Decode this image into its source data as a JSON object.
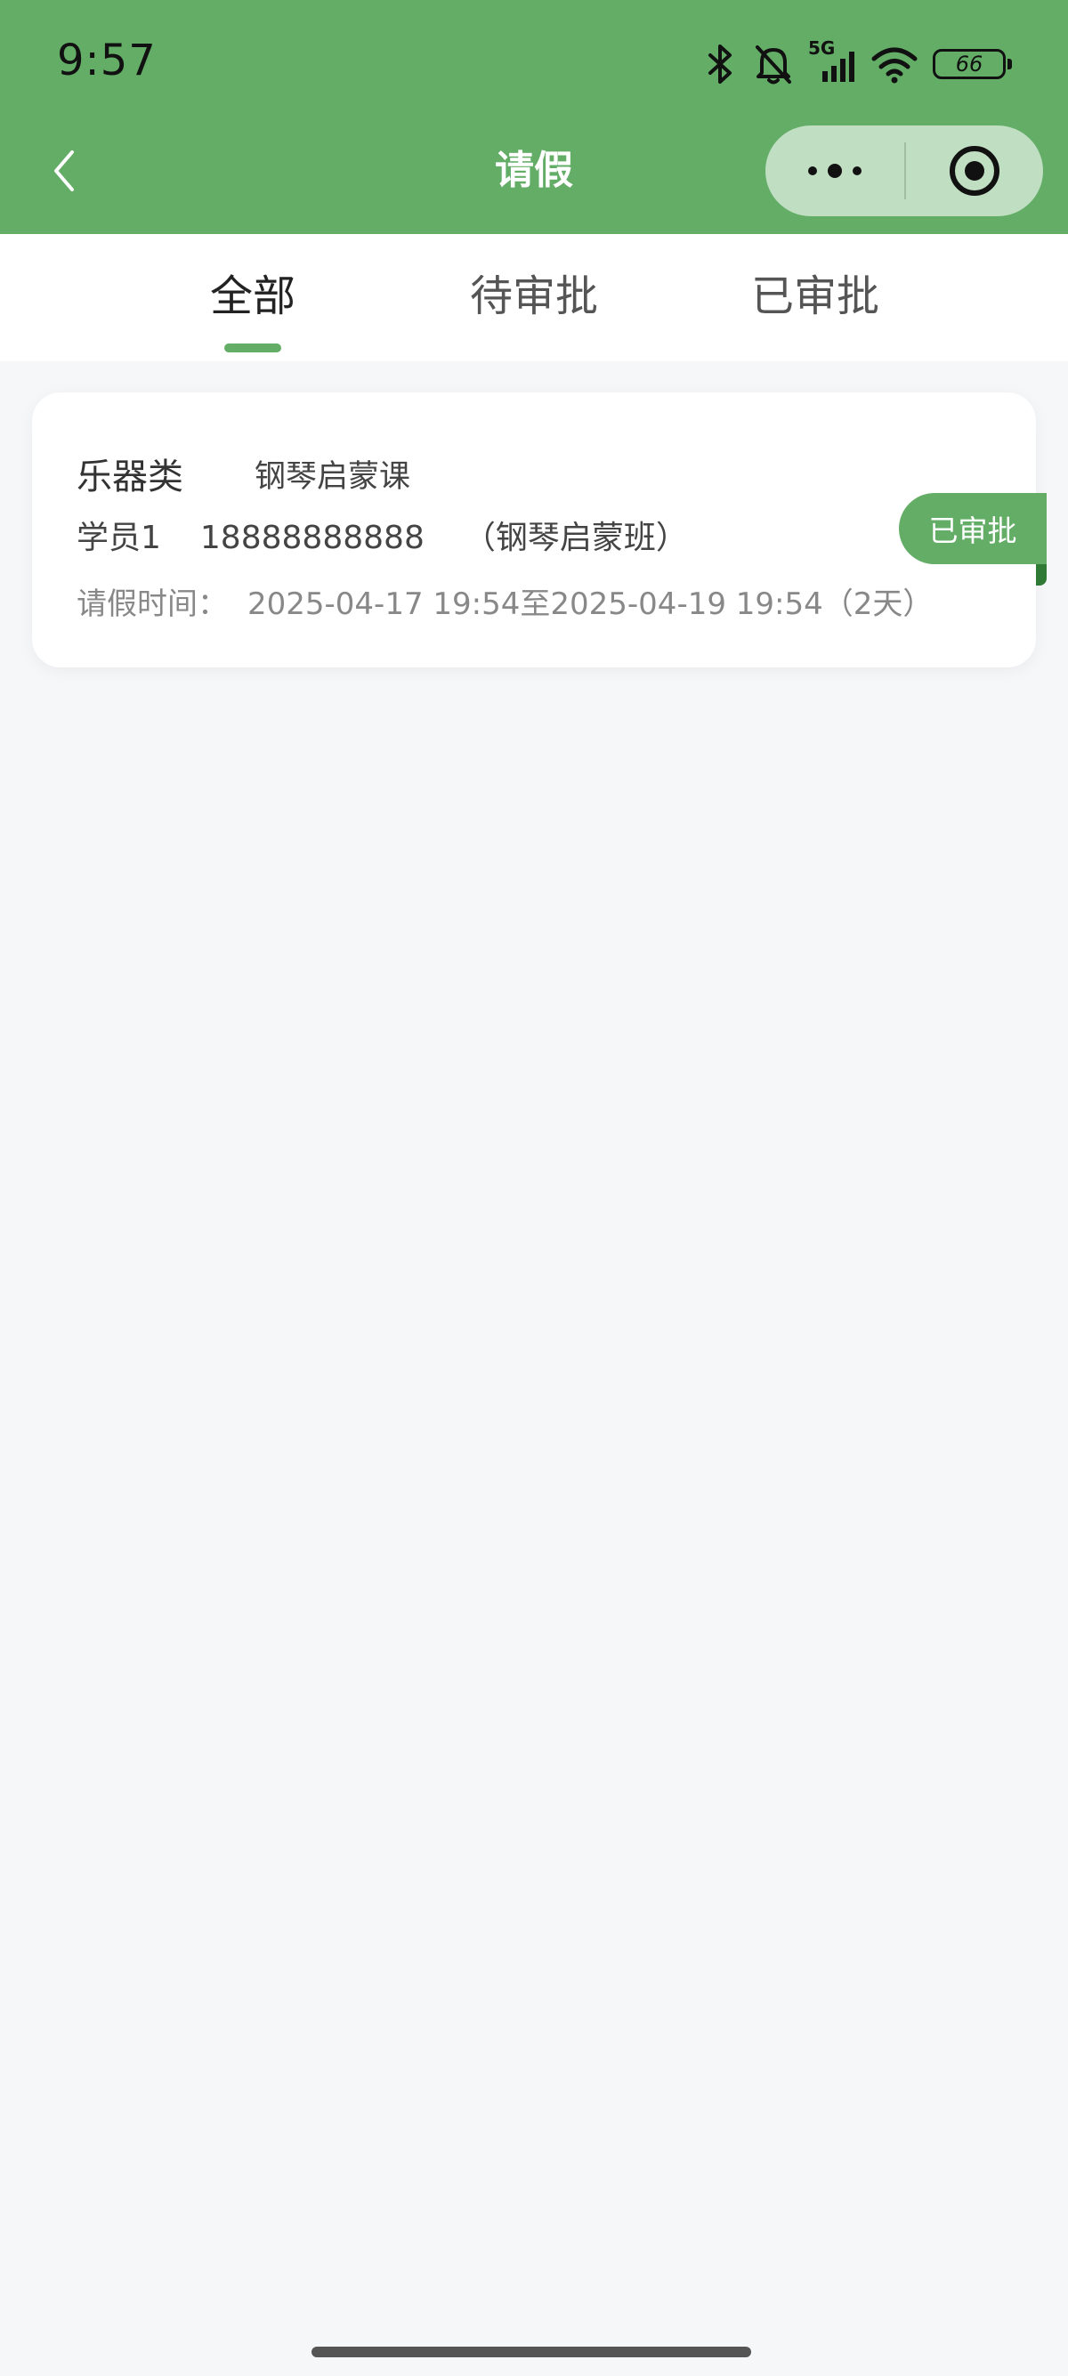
{
  "status_bar": {
    "time": "9:57",
    "network": "5G",
    "battery": "66",
    "icons": [
      "bluetooth-icon",
      "mute-bell-icon",
      "signal-icon",
      "wifi-icon",
      "battery-icon"
    ]
  },
  "nav": {
    "title": "请假",
    "back_icon": "chevron-left-icon",
    "more_icon": "more-dots-icon",
    "close_icon": "target-close-icon"
  },
  "tabs": [
    {
      "label": "全部",
      "active": true
    },
    {
      "label": "待审批",
      "active": false
    },
    {
      "label": "已审批",
      "active": false
    }
  ],
  "leave_requests": [
    {
      "category": "乐器类",
      "course": "钢琴启蒙课",
      "student": "学员1",
      "phone": "18888888888",
      "class_name": "（钢琴启蒙班）",
      "time_label": "请假时间：",
      "time_range": "2025-04-17 19:54至2025-04-19 19:54（2天）",
      "status": "已审批"
    }
  ],
  "colors": {
    "primary": "#63AD67",
    "background": "#F6F7F9",
    "tag_fold": "#2F7A34"
  }
}
